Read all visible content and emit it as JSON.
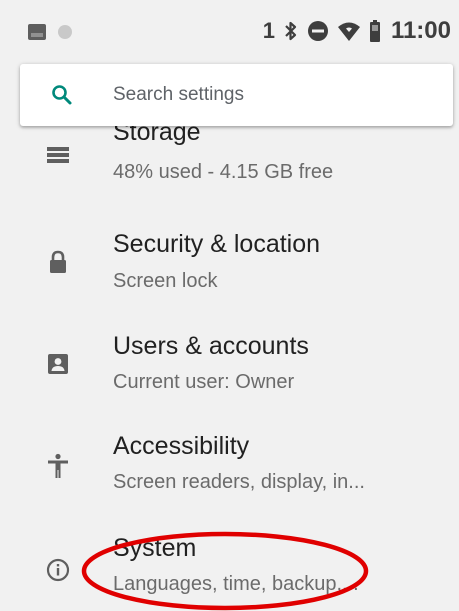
{
  "status_bar": {
    "notification_count": "1",
    "time": "11:00",
    "icons": [
      "image-icon",
      "dot-icon",
      "bluetooth-icon",
      "do-not-disturb-icon",
      "wifi-icon",
      "battery-icon"
    ]
  },
  "search": {
    "placeholder": "Search settings",
    "icon": "search-icon"
  },
  "settings": {
    "items": [
      {
        "title": "Storage",
        "summary": "48% used - 4.15 GB free",
        "icon": "storage-icon"
      },
      {
        "title": "Security & location",
        "summary": "Screen lock",
        "icon": "lock-icon"
      },
      {
        "title": "Users & accounts",
        "summary": "Current user: Owner",
        "icon": "account-box-icon"
      },
      {
        "title": "Accessibility",
        "summary": "Screen readers, display, in...",
        "icon": "accessibility-icon"
      },
      {
        "title": "System",
        "summary": "Languages, time, backup,...",
        "icon": "info-icon"
      }
    ]
  },
  "colors": {
    "background": "#f1f1f1",
    "accent": "#00897b",
    "annotation": "#e00000"
  }
}
